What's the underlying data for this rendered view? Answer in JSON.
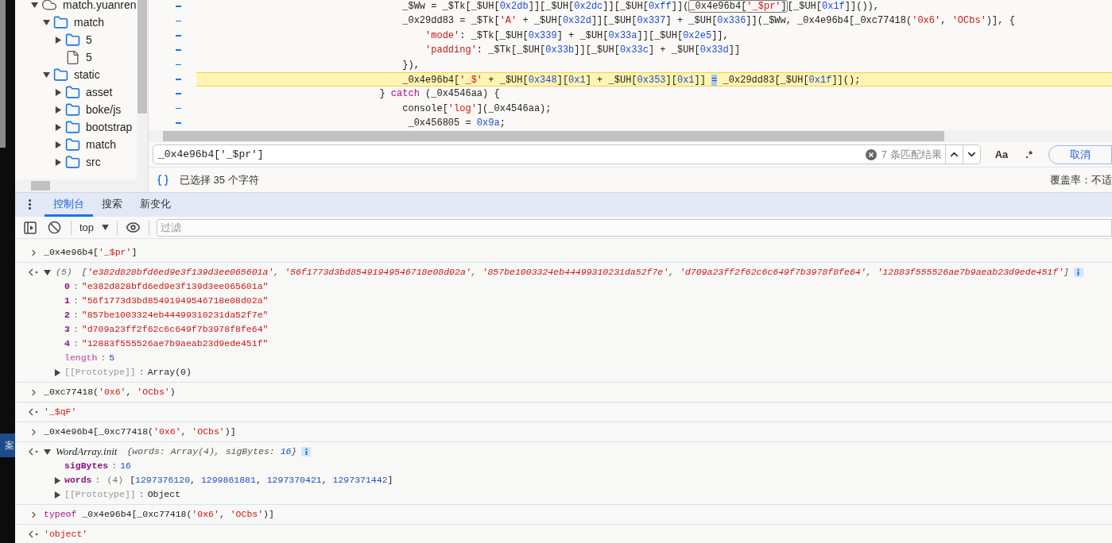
{
  "left_edge": {
    "label": "案"
  },
  "file_tree": [
    {
      "label": "match.yuanren",
      "kind": "cloud",
      "expanded": true,
      "children": [
        {
          "label": "match",
          "kind": "folder",
          "expanded": true,
          "children": [
            {
              "label": "5",
              "kind": "folder",
              "expanded": false
            },
            {
              "label": "5",
              "kind": "file"
            }
          ]
        },
        {
          "label": "static",
          "kind": "folder",
          "expanded": true,
          "children": [
            {
              "label": "asset",
              "kind": "folder",
              "expanded": false
            },
            {
              "label": "boke/js",
              "kind": "folder",
              "expanded": false
            },
            {
              "label": "bootstrap",
              "kind": "folder",
              "expanded": false
            },
            {
              "label": "match",
              "kind": "folder",
              "expanded": false
            },
            {
              "label": "src",
              "kind": "folder",
              "expanded": false
            }
          ]
        }
      ]
    }
  ],
  "editor": {
    "lines": [
      {
        "highlighted": false,
        "parts": [
          {
            "text": "                                    _$Ww = _$Tk[_$UH[0x2db]][_$UH[0x2dc]][_$UH[0xff]](",
            "kind": "code"
          },
          {
            "text": "_0x4e96b4['_$pr']",
            "kind": "search-match"
          },
          {
            "text": "[_$UH[0x1f]]()),",
            "kind": "code"
          }
        ]
      },
      {
        "highlighted": false,
        "parts": [
          {
            "text": "                                    _0x29dd83 = _$Tk['A' + _$UH[0x32d]][_$UH[0x337] + _$UH[0x336]](_$Ww, _0x4e96b4[_0xc77418('0x6', 'OCbs')], {",
            "kind": "code"
          }
        ]
      },
      {
        "highlighted": false,
        "parts": [
          {
            "text": "                                        'mode': _$Tk[_$UH[0x339] + _$UH[0x33a]][_$UH[0x2e5]],",
            "kind": "code"
          }
        ]
      },
      {
        "highlighted": false,
        "parts": [
          {
            "text": "                                        'padding': _$Tk[_$UH[0x33b]][_$UH[0x33c] + _$UH[0x33d]]",
            "kind": "code"
          }
        ]
      },
      {
        "highlighted": false,
        "parts": [
          {
            "text": "                                    }),",
            "kind": "code"
          }
        ]
      },
      {
        "highlighted": true,
        "parts": [
          {
            "text": "                                    _0x4e96b4['_$' + _$UH[0x348][0x1] + _$UH[0x353][0x1]] ",
            "kind": "code"
          },
          {
            "text": "=",
            "kind": "selection"
          },
          {
            "text": " _0x29dd83[_$UH[0x1f]]();",
            "kind": "code"
          }
        ]
      },
      {
        "highlighted": false,
        "parts": [
          {
            "text": "                                } ",
            "kind": "code"
          },
          {
            "text": "catch",
            "kind": "keyword"
          },
          {
            "text": " (_0x4546aa) {",
            "kind": "code"
          }
        ]
      },
      {
        "highlighted": false,
        "parts": [
          {
            "text": "                                    console['log'](_0x4546aa);",
            "kind": "code"
          }
        ]
      },
      {
        "highlighted": false,
        "parts": [
          {
            "text": "                                     _0x456805 = 0x9a;",
            "kind": "code"
          }
        ]
      }
    ]
  },
  "search": {
    "value": "_0x4e96b4['_$pr']",
    "match_count": "7 条匹配结果",
    "case_button": "Aa",
    "regex_button": ".*",
    "cancel_button": "取消"
  },
  "status_bar": {
    "selection": "已选择 35 个字符",
    "coverage": "覆盖率：不适"
  },
  "drawer_tabs": [
    {
      "label": "控制台",
      "selected": true
    },
    {
      "label": "搜索",
      "selected": false
    },
    {
      "label": "新变化",
      "selected": false
    }
  ],
  "console_toolbar": {
    "context": "top",
    "filter_placeholder": "过滤"
  },
  "console": [
    {
      "kind": "input",
      "parts": [
        {
          "text": "_0x4e96b4['_$pr']",
          "kind": "code"
        }
      ]
    },
    {
      "kind": "object",
      "expanded": true,
      "count": "(5)",
      "preview": "['e382d828bfd6ed9e3f139d3ee065601a', '56f1773d3bd85491949546718e08d02a', '857be1003324eb44499310231da52f7e', 'd709a23ff2f62c6c649f7b3978f8fe64', '12883f555526ae7b9aeab23d9ede451f']",
      "properties": [
        {
          "key": "0",
          "kind": "enumerable",
          "separator": ":",
          "value": "\"e382d828bfd6ed9e3f139d3ee065601a\""
        },
        {
          "key": "1",
          "kind": "enumerable",
          "separator": ":",
          "value": "\"56f1773d3bd85491949546718e08d02a\""
        },
        {
          "key": "2",
          "kind": "enumerable",
          "separator": ":",
          "value": "\"857be1003324eb44499310231da52f7e\""
        },
        {
          "key": "3",
          "kind": "enumerable",
          "separator": ":",
          "value": "\"d709a23ff2f62c6c649f7b3978f8fe64\""
        },
        {
          "key": "4",
          "kind": "enumerable",
          "separator": ":",
          "value": "\"12883f555526ae7b9aeab23d9ede451f\""
        },
        {
          "key": "length",
          "kind": "non-enumerable",
          "separator": ":",
          "value": "5"
        },
        {
          "key": "[[Prototype]]",
          "kind": "internal",
          "separator": ":",
          "value": "Array(0)",
          "expanded": false
        }
      ]
    },
    {
      "kind": "input",
      "parts": [
        {
          "text": "_0xc77418('0x6', 'OCbs')",
          "kind": "code"
        }
      ]
    },
    {
      "kind": "value",
      "text": "'_$qF'"
    },
    {
      "kind": "input",
      "parts": [
        {
          "text": "_0x4e96b4[_0xc77418('0x6', 'OCbs')]",
          "kind": "code"
        }
      ]
    },
    {
      "kind": "object",
      "expanded": true,
      "type_name": "WordArray.init",
      "preview": "{words: Array(4), sigBytes: 16}",
      "properties": [
        {
          "key": "sigBytes",
          "kind": "enumerable",
          "separator": ":",
          "value": "16"
        },
        {
          "key": "words",
          "kind": "enumerable",
          "separator": ":",
          "count": "(4)",
          "value": "[1297376120, 1299861881, 1297370421, 1297371442]",
          "expanded": false
        },
        {
          "key": "[[Prototype]]",
          "kind": "internal",
          "separator": ":",
          "value": "Object",
          "expanded": false
        }
      ]
    },
    {
      "kind": "input",
      "parts": [
        {
          "text": "typeof",
          "kind": "keyword"
        },
        {
          "text": " _0x4e96b4[_0xc77418('0x6', 'OCbs')]",
          "kind": "code"
        }
      ]
    },
    {
      "kind": "value",
      "text": "'object'"
    }
  ]
}
